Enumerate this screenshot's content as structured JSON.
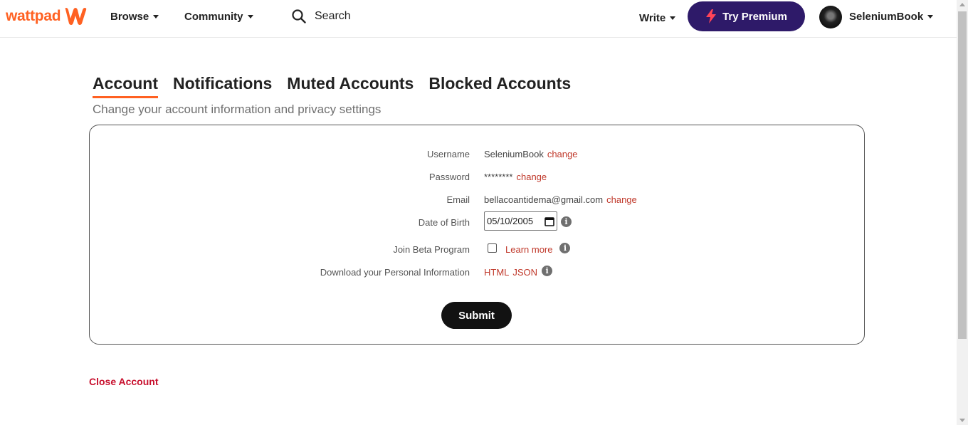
{
  "header": {
    "logo_text": "wattpad",
    "nav": {
      "browse": "Browse",
      "community": "Community"
    },
    "search_label": "Search",
    "write_label": "Write",
    "premium_label": "Try Premium",
    "username": "SeleniumBook"
  },
  "tabs": [
    {
      "label": "Account",
      "active": true
    },
    {
      "label": "Notifications",
      "active": false
    },
    {
      "label": "Muted Accounts",
      "active": false
    },
    {
      "label": "Blocked Accounts",
      "active": false
    }
  ],
  "subtitle": "Change your account information and privacy settings",
  "form": {
    "username": {
      "label": "Username",
      "value": "SeleniumBook",
      "link": "change"
    },
    "password": {
      "label": "Password",
      "value": "********",
      "link": "change"
    },
    "email": {
      "label": "Email",
      "value": "bellacoantidema@gmail.com",
      "link": "change"
    },
    "dob": {
      "label": "Date of Birth",
      "value": "05/10/2005"
    },
    "beta": {
      "label": "Join Beta Program",
      "checked": false,
      "link": "Learn more"
    },
    "download": {
      "label": "Download your Personal Information",
      "html": "HTML",
      "json": "JSON"
    },
    "submit_label": "Submit"
  },
  "close_account_label": "Close Account",
  "colors": {
    "brand": "#ff6122",
    "premium": "#2e1a69",
    "link": "#c0392b",
    "danger": "#c8102e"
  }
}
